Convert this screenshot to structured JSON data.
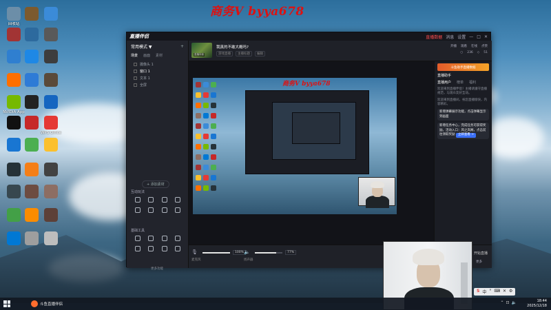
{
  "watermark": "商务V byya678",
  "inner_watermark": "商务V byya678",
  "desktop_icons": [
    {
      "label": "回收站",
      "color": "#6c8ea8"
    },
    {
      "label": "",
      "color": "#7c5a2e"
    },
    {
      "label": "",
      "color": "#3b8bd8"
    },
    {
      "label": "",
      "color": "#a23434"
    },
    {
      "label": "",
      "color": "#2d6a9e"
    },
    {
      "label": "",
      "color": "#595959"
    },
    {
      "label": "",
      "color": "#2f7fd0"
    },
    {
      "label": "",
      "color": "#1e88e5"
    },
    {
      "label": "",
      "color": "#3d3d3d"
    },
    {
      "label": "",
      "color": "#ff6f00"
    },
    {
      "label": "",
      "color": "#2e7bd6"
    },
    {
      "label": "",
      "color": "#5a4a3a"
    },
    {
      "label": "NVIDIA App",
      "color": "#76b900"
    },
    {
      "label": "",
      "color": "#222222"
    },
    {
      "label": "",
      "color": "#1565c0"
    },
    {
      "label": "",
      "color": "#111111"
    },
    {
      "label": "",
      "color": "#c62828"
    },
    {
      "label": "WPS Office",
      "color": "#e53935"
    },
    {
      "label": "",
      "color": "#1976d2"
    },
    {
      "label": "",
      "color": "#4caf50"
    },
    {
      "label": "",
      "color": "#fbc02d"
    },
    {
      "label": "",
      "color": "#263238"
    },
    {
      "label": "",
      "color": "#f57f17"
    },
    {
      "label": "",
      "color": "#424242"
    },
    {
      "label": "",
      "color": "#37474f"
    },
    {
      "label": "",
      "color": "#6d4c41"
    },
    {
      "label": "",
      "color": "#8d6e63"
    },
    {
      "label": "",
      "color": "#43a047"
    },
    {
      "label": "",
      "color": "#fb8c00"
    },
    {
      "label": "",
      "color": "#5d4037"
    },
    {
      "label": "",
      "color": "#0078d4"
    },
    {
      "label": "",
      "color": "#9e9e9e"
    },
    {
      "label": "",
      "color": "#bdbdbd"
    }
  ],
  "app": {
    "logo": "直播伴侣",
    "titlebar_actions": [
      "直播数据",
      "消息",
      "设置",
      "—",
      "□",
      "✕"
    ],
    "sidebar": {
      "header": "常用模式 ▼",
      "tabs": [
        "场景",
        "画面",
        "素材"
      ],
      "scenes": [
        "摄像头 1",
        "窗口 1",
        "文本 1",
        "全屏"
      ],
      "add_source": "+ 添加素材",
      "interact_title": "互动玩法",
      "interact_tools": [
        "",
        "",
        "",
        "",
        "",
        "",
        "",
        ""
      ],
      "basic_title": "基础工具",
      "basic_tools": [
        "",
        "",
        "",
        "",
        "",
        "",
        "",
        ""
      ],
      "more": "更多功能"
    },
    "room": {
      "title": "我真的不敢大概吗?",
      "tags": [
        "游戏直播",
        "主播标题",
        "编辑"
      ],
      "thumb_label": "直播封面",
      "top_right": [
        "开播",
        "观看",
        "在线",
        "点赞"
      ],
      "stats": [
        "○",
        "236",
        "◇",
        "51"
      ]
    },
    "bottom": {
      "mic_pct": "100%",
      "speaker_pct": "77%",
      "mic_label": "麦克风",
      "speaker_label": "扬声器",
      "start": "开始直播"
    },
    "right_panel": {
      "banner": "斗鱼助手直播数据",
      "title": "直播助手",
      "tabs": [
        "直播用户",
        "榜单",
        "福利"
      ],
      "text1": "欢迎来到直播伴侣！主播请遵守直播规范，与观众友好互动。",
      "text2": "欢迎来到直播间，祝您直播愉快，内容精彩。",
      "bubble1": "新增弹幕展示功能，点击弹幕显示到画面",
      "bubble2": "新增任务中心，完成任务可获得奖励。活动入口：风之岚阁，点击前往领取奖励",
      "bubble_btn": "立即查看 >",
      "bottom_label": "更多"
    }
  },
  "taskbar": {
    "running_app": "斗鱼直播伴侣",
    "tray": [
      "S",
      "中",
      "°",
      "⌨",
      "✕",
      "⚙"
    ],
    "time": "18:44",
    "date": "2025/12/18"
  }
}
